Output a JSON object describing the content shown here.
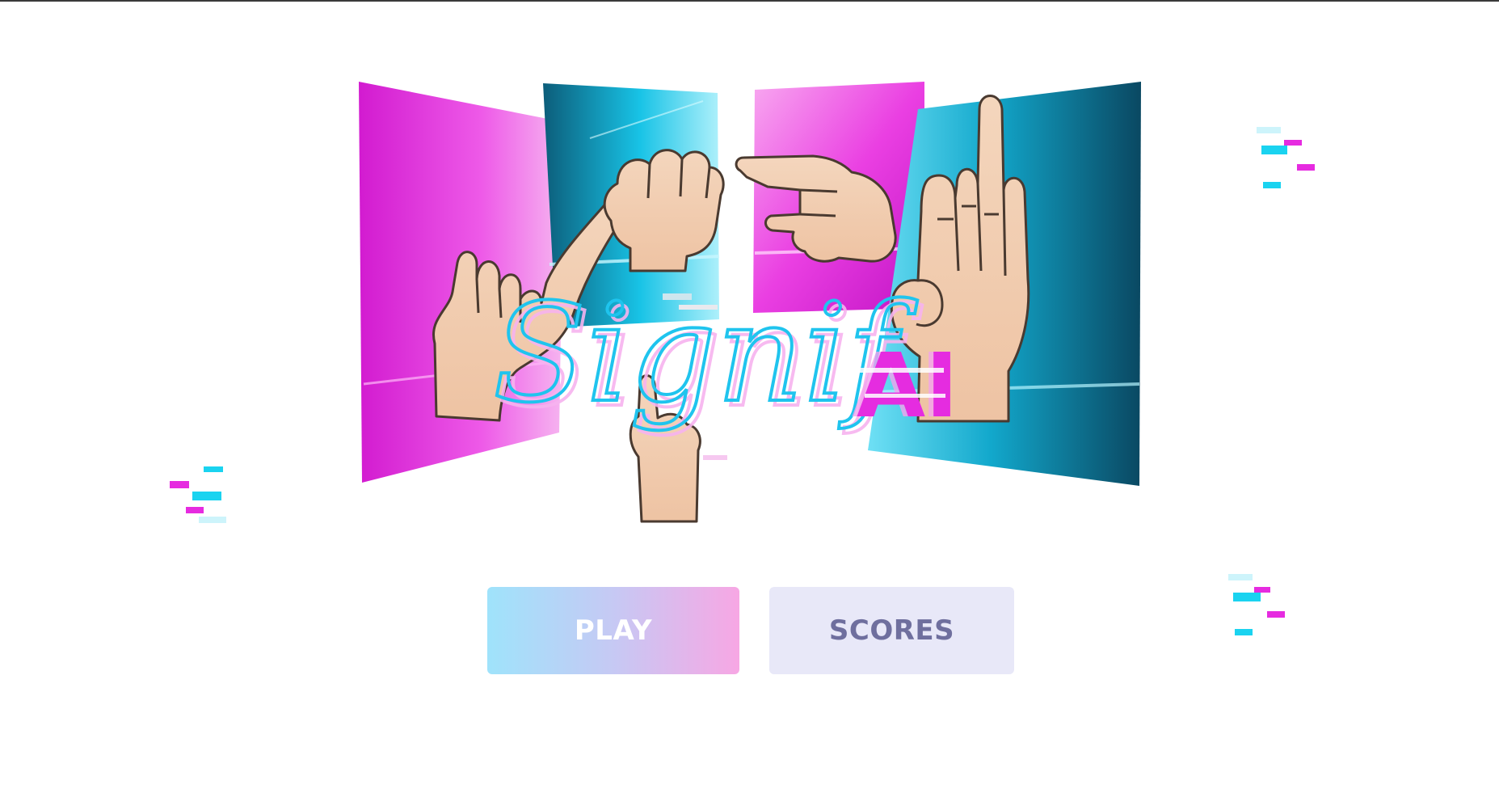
{
  "app": {
    "logo_text": "SignifAI",
    "logo_script_part": "Signif",
    "logo_block_part": "AI"
  },
  "menu": {
    "play_label": "PLAY",
    "scores_label": "SCORES"
  },
  "colors": {
    "magenta": "#e62be0",
    "cyan": "#1ad3f0",
    "teal_dark": "#0b4e6a",
    "skin": "#f1cdb0",
    "outline": "#4a3a30",
    "play_gradient_start": "#9fe3fb",
    "play_gradient_end": "#f7a7e4",
    "scores_bg": "#e8e8f8",
    "scores_text": "#6f6f9e"
  },
  "icons": [
    "hand-sign-l-icon",
    "hand-sign-fist-icon",
    "hand-sign-point-icon",
    "hand-sign-three-icon",
    "hand-sign-i-icon"
  ]
}
